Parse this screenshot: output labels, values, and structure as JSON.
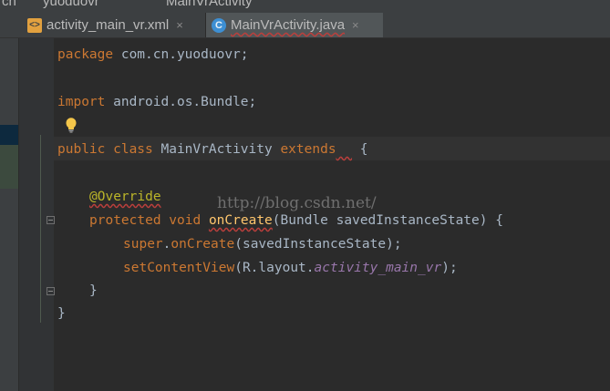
{
  "breadcrumbs": [
    "cn",
    "yuoduovr",
    "MainVrActivity"
  ],
  "tabs": [
    {
      "label": "activity_main_vr.xml",
      "icon": "xml-file-icon",
      "active": false
    },
    {
      "label": "MainVrActivity.java",
      "icon": "java-class-icon",
      "active": true
    }
  ],
  "close_glyph": "×",
  "code": {
    "line1": {
      "kw": "package",
      "rest": " com.cn.yuoduovr;"
    },
    "line2": {
      "kw": "import",
      "rest": " android.os.Bundle;"
    },
    "line3": {
      "kw": "public class",
      "name": " MainVrActivity ",
      "kw2": "extends",
      "gap": "  ",
      "brace": "{"
    },
    "line4": {
      "annotation": "@Override"
    },
    "line5": {
      "kw": "protected void",
      "method": "onCreate",
      "rest": "(Bundle savedInstanceState) {"
    },
    "line6": {
      "kw": "super",
      "dot": ".",
      "method": "onCreate",
      "rest": "(savedInstanceState);"
    },
    "line7": {
      "method": "setContentView",
      "open": "(R.layout.",
      "field": "activity_main_vr",
      "close": ");"
    },
    "line8": {
      "brace": "}"
    },
    "line9": {
      "brace": "}"
    }
  },
  "watermark": "http://blog.csdn.net/",
  "colors": {
    "background": "#2b2b2b",
    "keyword": "#cc7832",
    "annotation": "#bbb529",
    "method": "#ffc66d",
    "field": "#9876aa",
    "text": "#a9b7c6"
  }
}
